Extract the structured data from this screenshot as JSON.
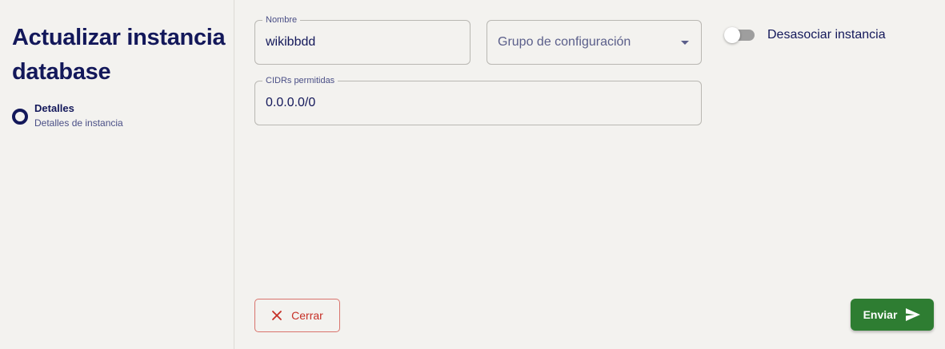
{
  "page": {
    "title": "Actualizar instancia database"
  },
  "steps": [
    {
      "label": "Detalles",
      "sublabel": "Detalles de instancia"
    }
  ],
  "form": {
    "nombre": {
      "legend": "Nombre",
      "value": "wikibbdd"
    },
    "grupo": {
      "placeholder": "Grupo de configuración"
    },
    "cidrs": {
      "legend": "CIDRs permitidas",
      "value": "0.0.0.0/0"
    },
    "toggle": {
      "label": "Desasociar instancia",
      "checked": false
    }
  },
  "actions": {
    "close_label": "Cerrar",
    "send_label": "Enviar"
  },
  "colors": {
    "primary_text": "#13185a",
    "send_button": "#2e7d32",
    "close_button": "#c62f26"
  },
  "icons": {
    "close": "close-icon",
    "send": "send-icon",
    "dropdown": "chevron-down-icon"
  }
}
